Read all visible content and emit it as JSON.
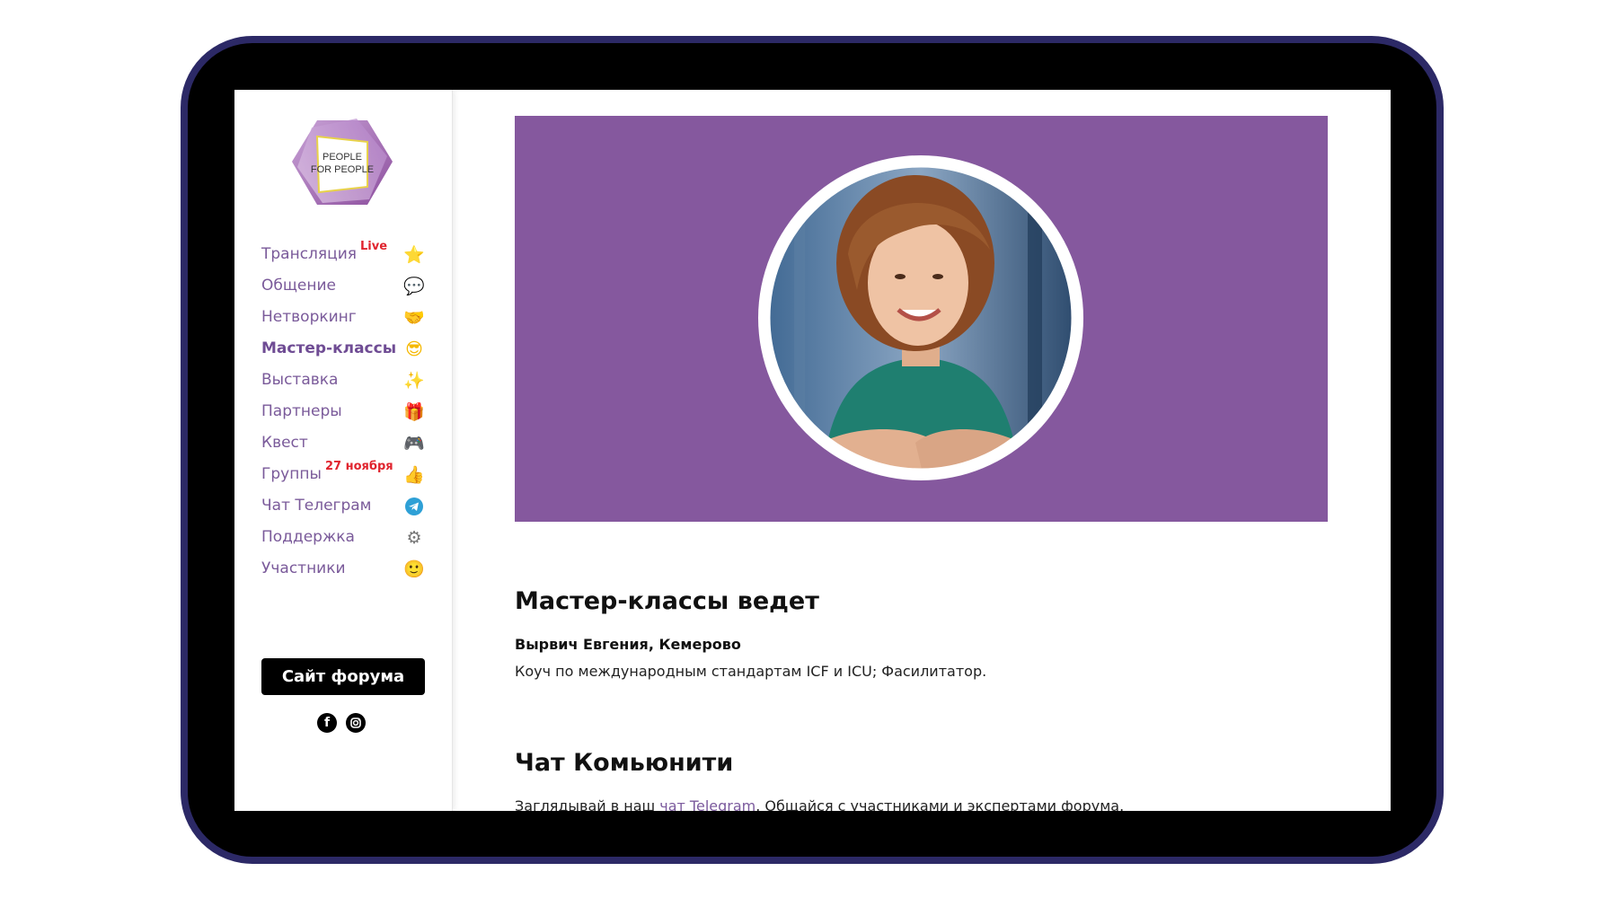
{
  "sidebar": {
    "logo_lines": [
      "PEOPLE",
      "FOR PEOPLE"
    ],
    "nav": [
      {
        "label": "Трансляция",
        "badge": "Live",
        "icon": "star-icon",
        "active": false
      },
      {
        "label": "Общение",
        "badge": "",
        "icon": "speech-bubble-icon",
        "active": false
      },
      {
        "label": "Нетворкинг",
        "badge": "",
        "icon": "handshake-icon",
        "active": false
      },
      {
        "label": "Мастер-классы",
        "badge": "",
        "icon": "sunglasses-face-icon",
        "active": true
      },
      {
        "label": "Выставка",
        "badge": "",
        "icon": "sparkles-icon",
        "active": false
      },
      {
        "label": "Партнеры",
        "badge": "",
        "icon": "gift-icon",
        "active": false
      },
      {
        "label": "Квест",
        "badge": "",
        "icon": "gamepad-icon",
        "active": false
      },
      {
        "label": "Группы",
        "badge": "27 ноября",
        "icon": "thumbs-up-icon",
        "active": false
      },
      {
        "label": "Чат Телеграм",
        "badge": "",
        "icon": "telegram-icon",
        "active": false
      },
      {
        "label": "Поддержка",
        "badge": "",
        "icon": "gear-icon",
        "active": false
      },
      {
        "label": "Участники",
        "badge": "",
        "icon": "smiley-icon",
        "active": false
      }
    ],
    "site_button": "Сайт форума",
    "socials": [
      "facebook-icon",
      "instagram-icon"
    ]
  },
  "main": {
    "banner_color": "#85589e",
    "host_title": "Мастер-классы ведет",
    "host_name": "Вырвич Евгения, Кемерово",
    "host_desc": "Коуч по международным стандартам ICF и ICU; Фасилитатор.",
    "community_title": "Чат Комьюнити",
    "community_text_before": "Заглядывай в наш ",
    "community_link": "чат Telegram",
    "community_text_after": ". Общайся с участниками и экспертами форума."
  },
  "colors": {
    "accent": "#7a5a9a",
    "badge": "#e0242e",
    "device_frame": "#2c2966"
  }
}
